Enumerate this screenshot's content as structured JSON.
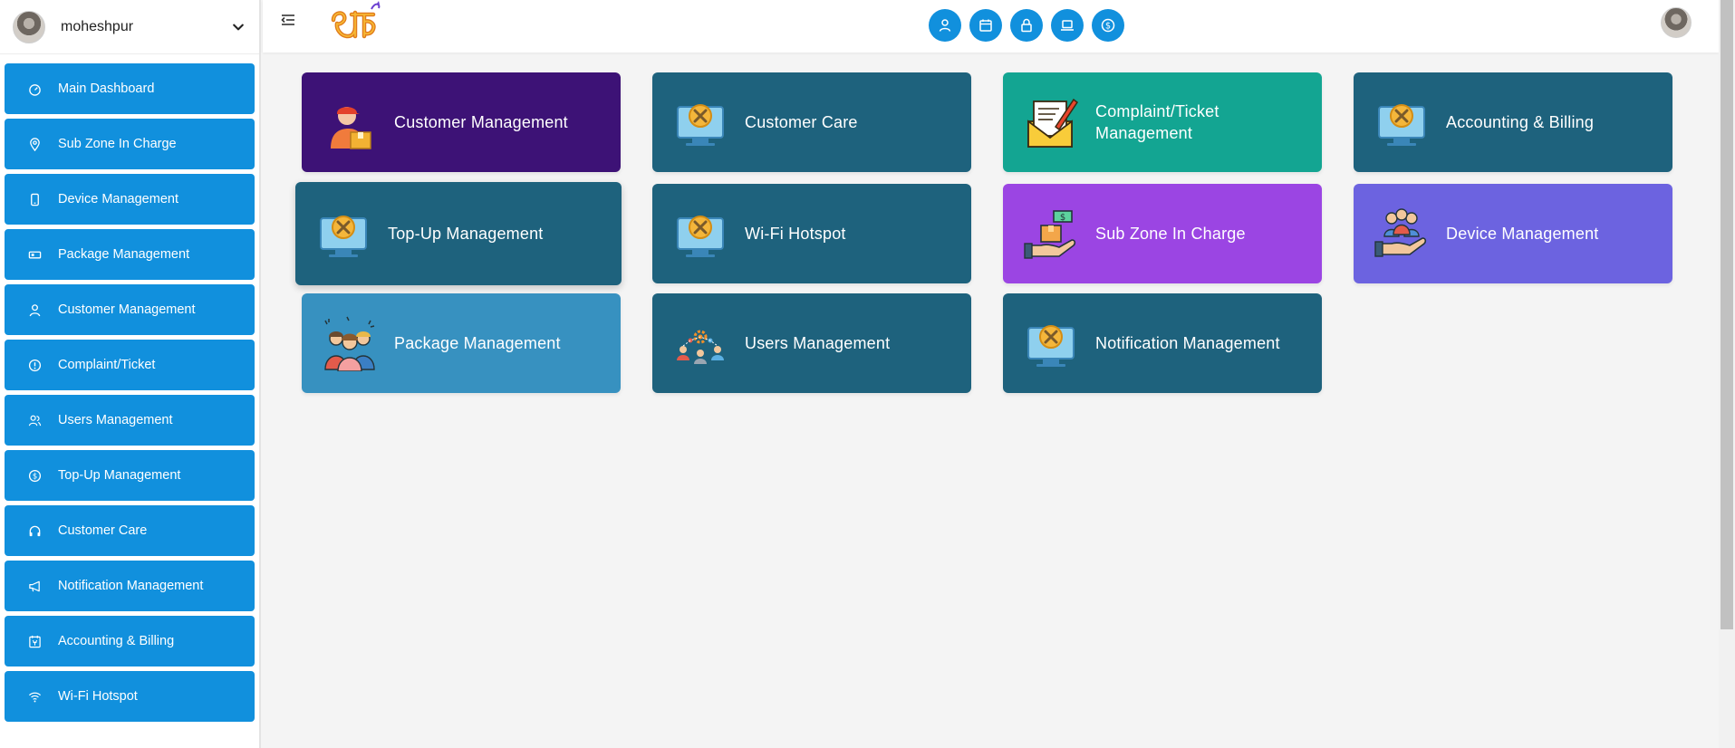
{
  "sidebar": {
    "user_name": "moheshpur",
    "items": [
      {
        "label": "Main Dashboard",
        "icon": "dashboard-icon"
      },
      {
        "label": "Sub Zone In Charge",
        "icon": "location-pin-icon"
      },
      {
        "label": "Device Management",
        "icon": "mobile-device-icon"
      },
      {
        "label": "Package Management",
        "icon": "package-icon"
      },
      {
        "label": "Customer Management",
        "icon": "user-icon"
      },
      {
        "label": "Complaint/Ticket",
        "icon": "alert-circle-icon"
      },
      {
        "label": "Users Management",
        "icon": "users-icon"
      },
      {
        "label": "Top-Up Management",
        "icon": "dollar-circle-icon"
      },
      {
        "label": "Customer Care",
        "icon": "headphones-icon"
      },
      {
        "label": "Notification Management",
        "icon": "megaphone-icon"
      },
      {
        "label": "Accounting & Billing",
        "icon": "billing-icon"
      },
      {
        "label": "Wi-Fi Hotspot",
        "icon": "wifi-icon"
      }
    ]
  },
  "topbar": {
    "quick_icons": [
      "user-icon",
      "calendar-icon",
      "lock-icon",
      "laptop-icon",
      "dollar-icon"
    ]
  },
  "tiles": [
    {
      "label": "Customer Management",
      "color": "#3d1276",
      "icon": "delivery-person-icon"
    },
    {
      "label": "Customer Care",
      "color": "#1e627d",
      "icon": "monitor-tools-icon"
    },
    {
      "label": "Complaint/Ticket Management",
      "color": "#13a592",
      "icon": "envelope-pencil-icon"
    },
    {
      "label": "Accounting & Billing",
      "color": "#1e627d",
      "icon": "monitor-tools-icon"
    },
    {
      "label": "Top-Up Management",
      "color": "#1e627d",
      "icon": "monitor-tools-icon"
    },
    {
      "label": "Wi-Fi Hotspot",
      "color": "#1e627d",
      "icon": "monitor-tools-icon"
    },
    {
      "label": "Sub Zone In Charge",
      "color": "#9b45e3",
      "icon": "hand-box-dollar-icon"
    },
    {
      "label": "Device Management",
      "color": "#6c63e0",
      "icon": "hand-people-icon"
    },
    {
      "label": "Package Management",
      "color": "#3791c0",
      "icon": "team-group-icon"
    },
    {
      "label": "Users Management",
      "color": "#1e627d",
      "icon": "network-users-icon"
    },
    {
      "label": "Notification Management",
      "color": "#1e627d",
      "icon": "monitor-tools-icon"
    }
  ]
}
